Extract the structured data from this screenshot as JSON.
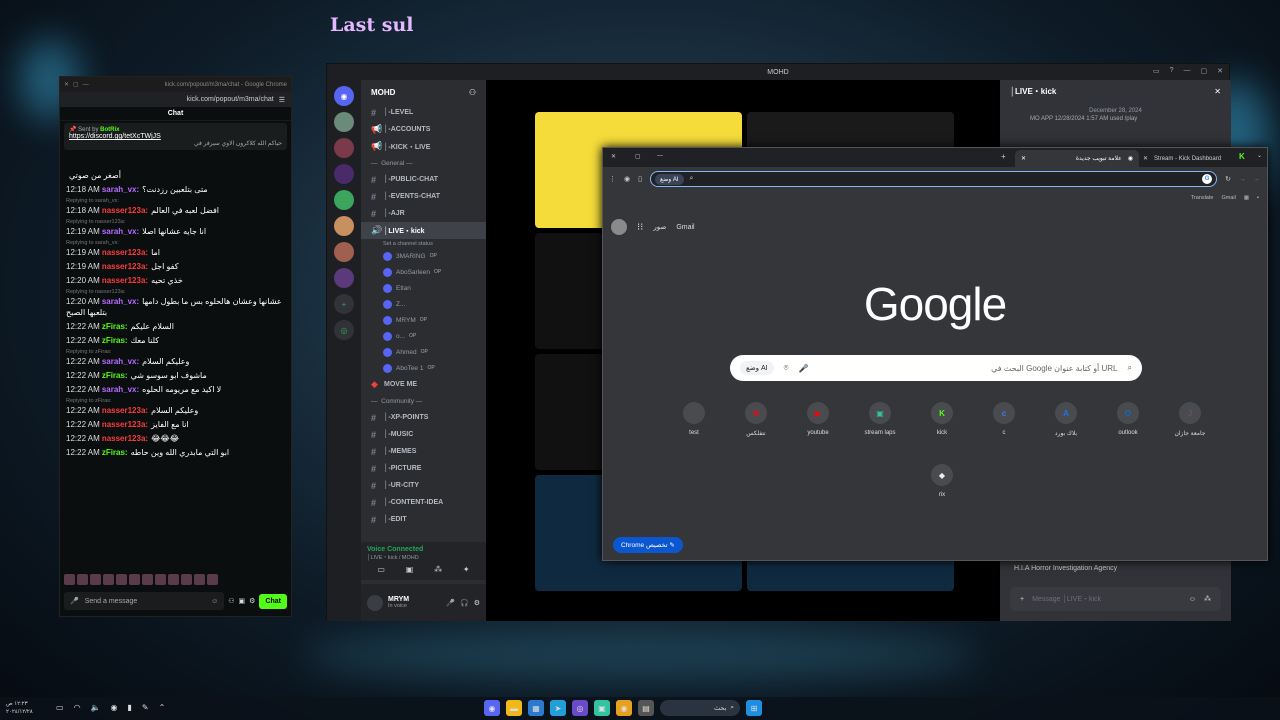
{
  "wallpaper": {
    "title": "Last sul"
  },
  "kick": {
    "window_title": "kick.com/popout/m3ma/chat - Google Chrome",
    "url": "kick.com/popout/m3ma/chat",
    "header": "Chat",
    "pinned_by": "Sent by",
    "pinned_user": "BotRix",
    "pinned_link": "https://discord.gg/tetXcTWjJS",
    "pinned_text": "حياكم الله كلاكرون الاوي سيرفر في",
    "messages": [
      {
        "reply": "",
        "time": "",
        "user": "",
        "text": "أصغر من صوتي",
        "color": "#ffffff"
      },
      {
        "reply": "",
        "time": "12:18 AM",
        "user": "sarah_vx:",
        "text": "متى بتلعبين رزدنت؟",
        "color": "#b66bff"
      },
      {
        "reply": "Replying to sarah_vx:",
        "time": "12:18 AM",
        "user": "nasser123a:",
        "text": "افضل لعبه في العالم",
        "color": "#ff3b3b"
      },
      {
        "reply": "Replying to nasser123a:",
        "time": "12:19 AM",
        "user": "sarah_vx:",
        "text": "انا جايه عشانها اصلا",
        "color": "#b66bff"
      },
      {
        "reply": "Replying to sarah_vx:",
        "time": "12:19 AM",
        "user": "nasser123a:",
        "text": "اما",
        "color": "#ff3b3b"
      },
      {
        "reply": "",
        "time": "12:19 AM",
        "user": "nasser123a:",
        "text": "كفو اجل",
        "color": "#ff3b3b"
      },
      {
        "reply": "",
        "time": "12:20 AM",
        "user": "nasser123a:",
        "text": "خذي تحيه",
        "color": "#ff3b3b"
      },
      {
        "reply": "Replying to nasser123a:",
        "time": "12:20 AM",
        "user": "sarah_vx:",
        "text": "عشانها وعشان هالحلوه بس ما بطول دامها بتلعبها الصبح",
        "color": "#b66bff"
      },
      {
        "reply": "",
        "time": "12:22 AM",
        "user": "zFiras:",
        "text": "السلام عليكم",
        "color": "#53fc18"
      },
      {
        "reply": "",
        "time": "12:22 AM",
        "user": "zFiras:",
        "text": "كلنا معك",
        "color": "#53fc18"
      },
      {
        "reply": "Replying to zFiras:",
        "time": "12:22 AM",
        "user": "sarah_vx:",
        "text": "وعليكم السلام",
        "color": "#b66bff"
      },
      {
        "reply": "",
        "time": "12:22 AM",
        "user": "zFiras:",
        "text": "ماشوف ابو سوسو شي",
        "color": "#53fc18"
      },
      {
        "reply": "",
        "time": "12:22 AM",
        "user": "sarah_vx:",
        "text": "لا اكيد مع مريومه الحلوه",
        "color": "#b66bff"
      },
      {
        "reply": "Replying to zFiras:",
        "time": "12:22 AM",
        "user": "nasser123a:",
        "text": "وعليكم السلام",
        "color": "#ff3b3b"
      },
      {
        "reply": "",
        "time": "12:22 AM",
        "user": "nasser123a:",
        "text": "انا مع الفايز",
        "color": "#ff3b3b"
      },
      {
        "reply": "",
        "time": "12:22 AM",
        "user": "nasser123a:",
        "text": "😂😂😂",
        "color": "#ff3b3b"
      },
      {
        "reply": "",
        "time": "12:22 AM",
        "user": "zFiras:",
        "text": "ابو التي مابدري الله وين حاطه",
        "color": "#53fc18"
      }
    ],
    "input_placeholder": "Send a message",
    "chat_button": "Chat"
  },
  "discord": {
    "window_title": "MOHD",
    "server_name": "MOHD",
    "channels_top": [
      {
        "icon": "#",
        "name": "│-LEVEL"
      },
      {
        "icon": "📢",
        "name": "│-ACCOUNTS"
      },
      {
        "icon": "📢",
        "name": "│-KICK・LIVE"
      }
    ],
    "category_general": "General",
    "channels_general": [
      {
        "icon": "#",
        "name": "│-PUBLIC-CHAT"
      },
      {
        "icon": "#",
        "name": "│-EVENTS-CHAT"
      },
      {
        "icon": "#",
        "name": "│-AJR"
      }
    ],
    "voice_channel": "│LIVE・kick",
    "voice_status": "Set a channel status",
    "voice_users": [
      {
        "name": "3MARING",
        "badge": "OP"
      },
      {
        "name": "AboSarleen",
        "badge": "OP"
      },
      {
        "name": "Etlan",
        "badge": ""
      },
      {
        "name": "Z...",
        "badge": ""
      },
      {
        "name": "MRYM",
        "badge": "OP"
      },
      {
        "name": "o...",
        "badge": "OP"
      },
      {
        "name": "Ahmed",
        "badge": "OP"
      },
      {
        "name": "AboTee 1",
        "badge": "OP"
      }
    ],
    "move_me": "MOVE ME",
    "category_community": "Community",
    "channels_community": [
      {
        "icon": "#",
        "name": "│-XP-POINTS"
      },
      {
        "icon": "#",
        "name": "│-MUSIC"
      },
      {
        "icon": "#",
        "name": "│-MEMES"
      },
      {
        "icon": "#",
        "name": "│-PICTURE"
      },
      {
        "icon": "#",
        "name": "│-UR-CITY"
      },
      {
        "icon": "#",
        "name": "│-CONTENT-IDEA"
      },
      {
        "icon": "#",
        "name": "│-EDIT"
      }
    ],
    "voice_connected": "Voice Connected",
    "voice_connected_sub": "│LIVE・kick / MOHD",
    "user_name": "MRYM",
    "user_status": "In voice",
    "right_header": "│LIVE・kick",
    "right_date": "December 28, 2024",
    "right_msg": "MO APP 12/28/2024 1:57 AM used /play",
    "right_bottom": "H.I.A Horror Investigation Agency",
    "msg_placeholder": "Message │LIVE・kick"
  },
  "chrome": {
    "tab1": "Stream - Kick Dashboard",
    "tab2": "علامة تبويب جديدة",
    "ai_mode": "وضع AI",
    "translate": "Translate",
    "gmail_bm": "Gmail",
    "gmail": "Gmail",
    "images": "صور",
    "logo": "Google",
    "search_placeholder": "البحث في Google أو كتابة عنوان URL",
    "shortcuts": [
      {
        "label": "test",
        "icon": "⚙",
        "color": "#4a4b4f"
      },
      {
        "label": "نتفلكس",
        "icon": "N",
        "color": "#e50914"
      },
      {
        "label": "youtube",
        "icon": "▶",
        "color": "#ff0000"
      },
      {
        "label": "stream laps",
        "icon": "▣",
        "color": "#31c3a2"
      },
      {
        "label": "kick",
        "icon": "K",
        "color": "#53fc18"
      },
      {
        "label": "c",
        "icon": "c",
        "color": "#3d7de6"
      },
      {
        "label": "بلاك بورد",
        "icon": "A",
        "color": "#1a73e8"
      },
      {
        "label": "outlook",
        "icon": "O",
        "color": "#0f6cbd"
      },
      {
        "label": "جامعة جازان",
        "icon": "J",
        "color": "#6b4e6b"
      },
      {
        "label": "rix",
        "icon": "◆",
        "color": "#eeeeee"
      }
    ],
    "customize": "Chrome تخصيص"
  },
  "taskbar": {
    "time": "١٢:٢٣ ص",
    "date": "٢٠٢٤/١٢/٢٨",
    "search": "بحث"
  }
}
